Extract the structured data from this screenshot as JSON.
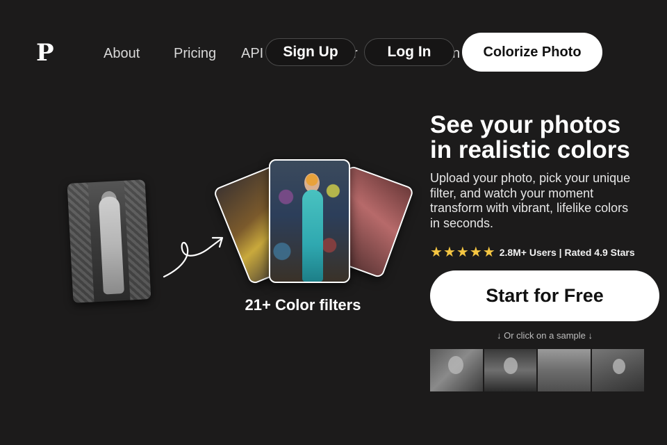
{
  "nav": {
    "logo": "P",
    "about": "About",
    "pricing": "Pricing",
    "api": "API",
    "hidden_fragment_1": "r",
    "hidden_fragment_2": "n",
    "signup": "Sign Up",
    "login": "Log In",
    "cta": "Colorize Photo"
  },
  "hero": {
    "title_line1": "See your photos",
    "title_line2": "in realistic colors",
    "subtitle": "Upload your photo, pick your unique filter, and watch your moment transform with vibrant, lifelike colors in seconds.",
    "stars": [
      "★",
      "★",
      "★",
      "★",
      "★"
    ],
    "rating_text": "2.8M+ Users | Rated 4.9 Stars",
    "start_button": "Start for Free",
    "sample_hint": "↓ Or click on a sample ↓"
  },
  "visual": {
    "filters_caption": "21+ Color filters"
  },
  "colors": {
    "background": "#1c1b1b",
    "accent_white": "#ffffff",
    "star": "#f5c642"
  }
}
